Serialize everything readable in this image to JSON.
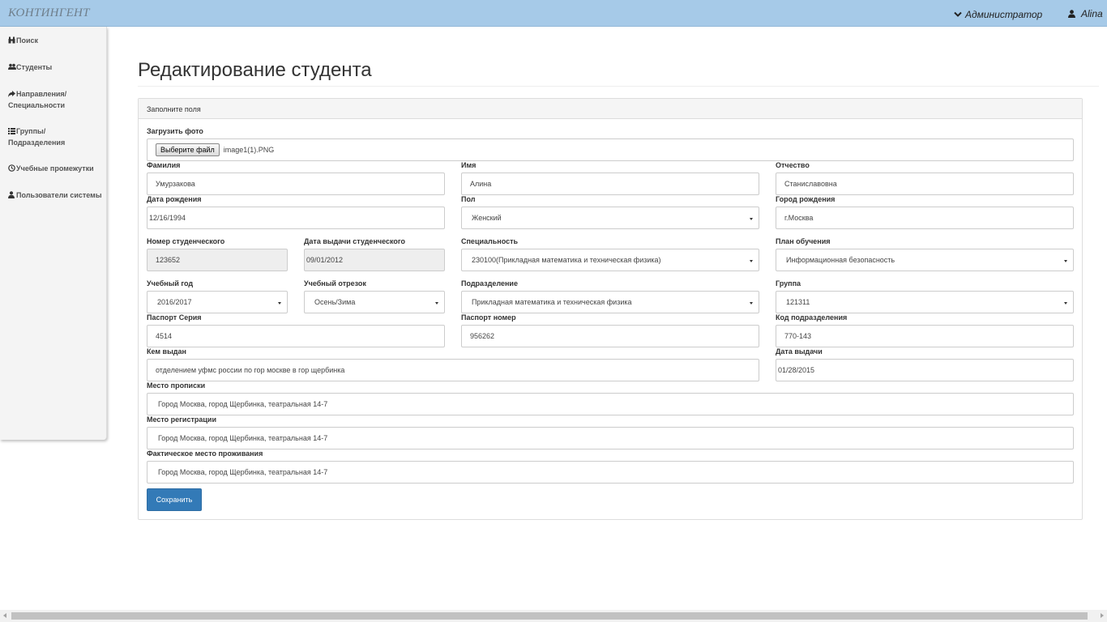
{
  "header": {
    "brand": "КОНТИНГЕНТ",
    "role_menu": "Администратор",
    "user_name": "Alina"
  },
  "sidebar": {
    "items": [
      {
        "label": "Поиск",
        "icon": "binoculars-icon"
      },
      {
        "label": "Студенты",
        "icon": "users-icon"
      },
      {
        "label": "Направления/ Специальности",
        "icon": "share-arrow-icon"
      },
      {
        "label": "Группы/ Подразделения",
        "icon": "list-icon"
      },
      {
        "label": "Учебные промежутки",
        "icon": "clock-icon"
      },
      {
        "label": "Пользователи системы",
        "icon": "user-icon"
      }
    ]
  },
  "page": {
    "title": "Редактирование студента"
  },
  "form": {
    "panel_heading": "Заполните поля",
    "photo": {
      "label": "Загрузить фото",
      "button": "Выберите файл",
      "file_name": "image1(1).PNG"
    },
    "last_name": {
      "label": "Фамилия",
      "value": "Умурзакова"
    },
    "first_name": {
      "label": "Имя",
      "value": "Алина"
    },
    "patronymic": {
      "label": "Отчество",
      "value": "Станиславовна"
    },
    "birth_date": {
      "label": "Дата рождения",
      "value": "12/16/1994"
    },
    "gender": {
      "label": "Пол",
      "value": "Женский"
    },
    "birth_city": {
      "label": "Город рождения",
      "value": "г.Москва"
    },
    "student_id": {
      "label": "Номер студенческого",
      "value": "123652"
    },
    "student_id_date": {
      "label": "Дата выдачи студенческого",
      "value": "09/01/2012"
    },
    "specialty": {
      "label": "Специальность",
      "value": "230100(Прикладная математика и техническая физика)"
    },
    "study_plan": {
      "label": "План обучения",
      "value": "Информационная безопасность"
    },
    "academic_year": {
      "label": "Учебный год",
      "value": "2016/2017"
    },
    "term": {
      "label": "Учебный отрезок",
      "value": "Осень/Зима"
    },
    "department": {
      "label": "Подразделение",
      "value": "Прикладная математика и техническая физика"
    },
    "group": {
      "label": "Группа",
      "value": "121311"
    },
    "passport_series": {
      "label": "Паспорт Серия",
      "value": "4514"
    },
    "passport_number": {
      "label": "Паспорт номер",
      "value": "956262"
    },
    "division_code": {
      "label": "Код подразделения",
      "value": "770-143"
    },
    "issued_by": {
      "label": "Кем выдан",
      "value": "отделением уфмс россии по гор москве в гор щербинка"
    },
    "issue_date": {
      "label": "Дата выдачи",
      "value": "01/28/2015"
    },
    "registration_place": {
      "label": "Место прописки",
      "value": "Город Москва, город Щербинка, театральная 14-7"
    },
    "registration_address": {
      "label": "Место регистрации",
      "value": "Город Москва, город Щербинка, театральная 14-7"
    },
    "actual_address": {
      "label": "Фактическое место проживания",
      "value": "Город Москва, город Щербинка, театральная 14-7"
    },
    "save_button": "Сохранить"
  }
}
